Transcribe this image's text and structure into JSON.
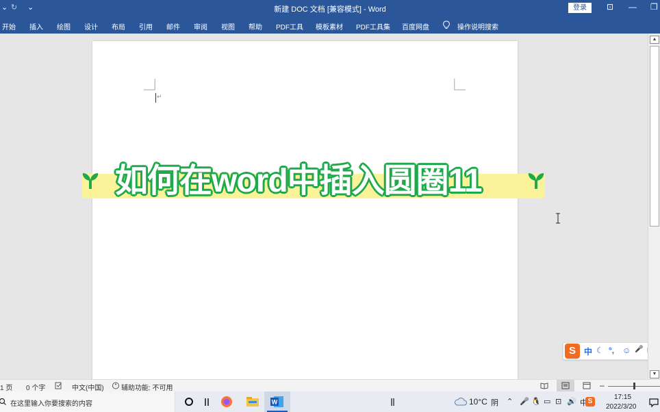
{
  "titlebar": {
    "title": "新建 DOC 文档 [兼容模式]  -  Word",
    "login_label": "登录"
  },
  "ribbon": {
    "tabs": [
      "开始",
      "插入",
      "绘图",
      "设计",
      "布局",
      "引用",
      "邮件",
      "审阅",
      "视图",
      "帮助",
      "PDF工具",
      "模板素材",
      "PDF工具集",
      "百度网盘",
      "操作说明搜索"
    ]
  },
  "document": {
    "paragraph_mark": "↵"
  },
  "banner": {
    "text": "如何在word中插入圆圈11",
    "colors": {
      "fill": "#ffffff",
      "outline": "#1fa94a",
      "highlight": "#fbf39a"
    }
  },
  "ime": {
    "items": [
      "中",
      "☾",
      "°,",
      "☺",
      "🎤",
      "⌨"
    ]
  },
  "statusbar": {
    "page": "1 页",
    "words": "0 个字",
    "language": "中文(中国)",
    "accessibility": "辅助功能: 不可用"
  },
  "taskbar": {
    "search_placeholder": "在这里输入你要搜索的内容",
    "weather_temp": "10°C",
    "weather_desc": "阴",
    "time": "17:15",
    "date": "2022/3/20"
  },
  "colors": {
    "accent": "#2b579a",
    "word_blue": "#185abd"
  }
}
